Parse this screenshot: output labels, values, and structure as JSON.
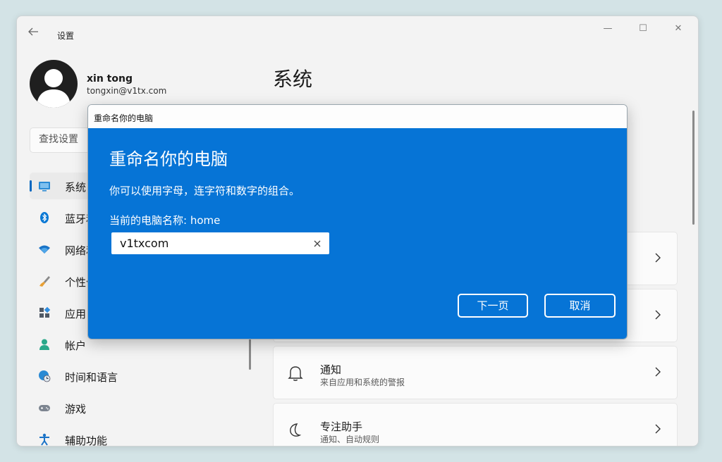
{
  "window": {
    "title": "设置",
    "controls": {
      "minimize": "—",
      "maximize": "☐",
      "close": "✕"
    }
  },
  "user": {
    "name": "xin tong",
    "email": "tongxin@v1tx.com"
  },
  "search": {
    "placeholder": "查找设置"
  },
  "sidebar": {
    "items": [
      {
        "label": "系统",
        "icon": "monitor-icon",
        "active": true
      },
      {
        "label": "蓝牙和",
        "icon": "bluetooth-icon"
      },
      {
        "label": "网络和",
        "icon": "wifi-icon"
      },
      {
        "label": "个性化",
        "icon": "brush-icon"
      },
      {
        "label": "应用",
        "icon": "apps-icon"
      },
      {
        "label": "帐户",
        "icon": "account-icon"
      },
      {
        "label": "时间和语言",
        "icon": "globe-clock-icon"
      },
      {
        "label": "游戏",
        "icon": "gamepad-icon"
      },
      {
        "label": "辅助功能",
        "icon": "accessibility-icon"
      }
    ]
  },
  "main": {
    "title": "系统",
    "cards": [
      {
        "title": "",
        "subtitle": ""
      },
      {
        "title": "",
        "subtitle": ""
      },
      {
        "title": "通知",
        "subtitle": "来自应用和系统的警报",
        "icon": "bell-icon"
      },
      {
        "title": "专注助手",
        "subtitle": "通知、自动规则",
        "icon": "moon-icon"
      }
    ]
  },
  "dialog": {
    "window_title": "重命名你的电脑",
    "heading": "重命名你的电脑",
    "description": "你可以使用字母，连字符和数字的组合。",
    "current_name_label": "当前的电脑名称: home",
    "input_value": "v1txcom",
    "next_button": "下一页",
    "cancel_button": "取消"
  },
  "colors": {
    "accent": "#0067c0",
    "dialog_background": "#0674d6",
    "window_background": "#f3f3f3",
    "desktop": "#d3e3e6"
  }
}
